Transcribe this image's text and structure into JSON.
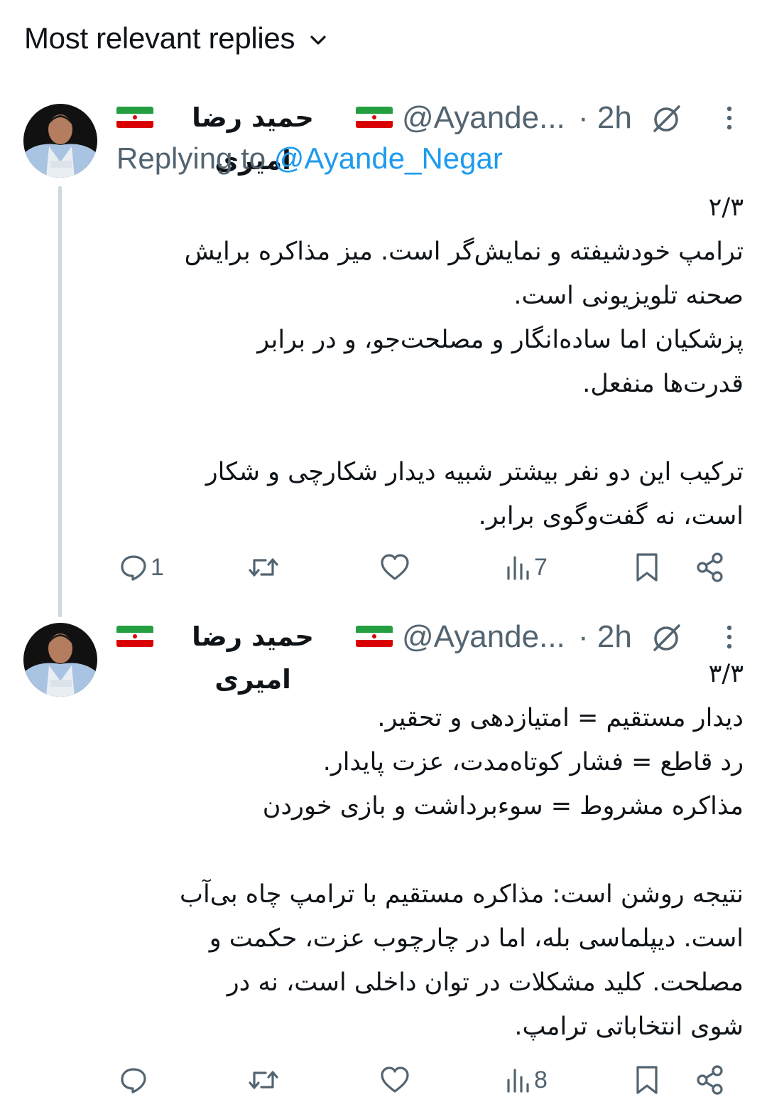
{
  "header": {
    "title": "Most relevant replies",
    "chevron_icon": "chevron-down-icon"
  },
  "colors": {
    "accent": "#1d9bf0",
    "muted": "#536471",
    "text": "#0f1419",
    "thread_line": "#cfd9de",
    "flag_green": "#239f40",
    "flag_red": "#da0000"
  },
  "tweets": [
    {
      "name": "حمید رضا امیری",
      "handle": "@Ayande...",
      "time": "· 2h",
      "replying_label": "Replying to",
      "replying_handle": "@Ayande_Negar",
      "body": "۲/۳\nترامپ خودشیفته و نمایش‌گر است. میز مذاکره برایش\nصحنه تلویزیونی است.\nپزشکیان اما ساده‌انگار و مصلحت‌جو، و در برابر\nقدرت‌ها منفعل.\n\nترکیب این دو نفر بیشتر شبیه دیدار شکارچی و شکار\nاست، نه گفت‌وگوی برابر.",
      "replies": "1",
      "retweets": "",
      "likes": "",
      "views": "7"
    },
    {
      "name": "حمید رضا امیری",
      "handle": "@Ayande...",
      "time": "· 2h",
      "body": "۳/۳\nدیدار مستقیم = امتیازدهی و تحقیر.\nرد قاطع = فشار کوتاه‌مدت، عزت پایدار.\nمذاکره مشروط = سوءبرداشت و بازی خوردن\n\nنتیجه روشن است: مذاکره مستقیم با ترامپ چاه بی‌آب\nاست. دیپلماسی بله، اما در چارچوب عزت، حکمت و\nمصلحت. کلید مشکلات در توان داخلی است، نه در\nشوی انتخاباتی ترامپ.",
      "replies": "",
      "retweets": "",
      "likes": "",
      "views": "8"
    }
  ]
}
